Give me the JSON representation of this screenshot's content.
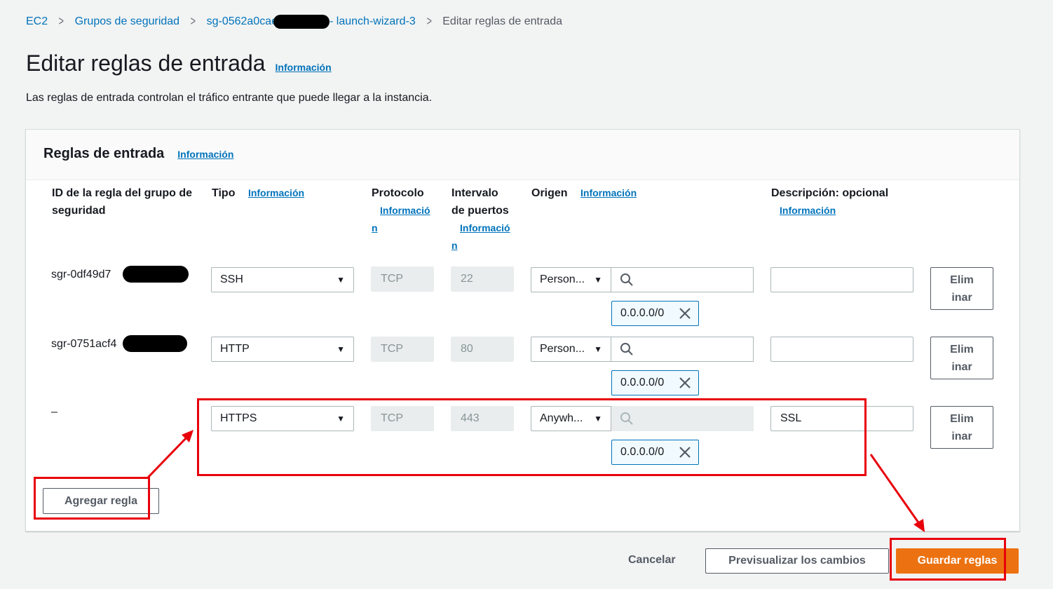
{
  "breadcrumb": {
    "items": [
      "EC2",
      "Grupos de seguridad"
    ],
    "sg_prefix": "sg-0562a0cae",
    "sg_suffix": "- launch-wizard-3",
    "current": "Editar reglas de entrada",
    "separator": ">"
  },
  "page": {
    "title": "Editar reglas de entrada",
    "info": "Información",
    "subtitle": "Las reglas de entrada controlan el tráfico entrante que puede llegar a la instancia."
  },
  "panel": {
    "title": "Reglas de entrada",
    "info": "Información",
    "columns": {
      "rule_id": "ID de la regla del grupo de seguridad",
      "type": "Tipo",
      "type_info": "Información",
      "protocol": "Protocolo",
      "protocol_info_a": "Informació",
      "protocol_info_b": "n",
      "port_range_a": "Intervalo",
      "port_range_b": "de puertos",
      "port_info_a": "Informació",
      "port_info_b": "n",
      "source": "Origen",
      "source_info": "Información",
      "description": "Descripción: opcional",
      "description_info": "Información"
    },
    "rows": [
      {
        "id": "sgr-0df49d7",
        "type": "SSH",
        "protocol": "TCP",
        "port": "22",
        "source_type": "Person...",
        "cidr": "0.0.0.0/0",
        "description": "",
        "delete_a": "Elim",
        "delete_b": "inar"
      },
      {
        "id": "sgr-0751acf4",
        "type": "HTTP",
        "protocol": "TCP",
        "port": "80",
        "source_type": "Person...",
        "cidr": "0.0.0.0/0",
        "description": "",
        "delete_a": "Elim",
        "delete_b": "inar"
      },
      {
        "id": "–",
        "type": "HTTPS",
        "protocol": "TCP",
        "port": "443",
        "source_type": "Anywh...",
        "cidr": "0.0.0.0/0",
        "description": "SSL",
        "delete_a": "Elim",
        "delete_b": "inar"
      }
    ],
    "add_rule": "Agregar regla"
  },
  "footer": {
    "cancel": "Cancelar",
    "preview": "Previsualizar los cambios",
    "save": "Guardar reglas"
  },
  "colors": {
    "link": "#0073bb",
    "primary": "#ec7211",
    "annotation": "#e8000b"
  }
}
